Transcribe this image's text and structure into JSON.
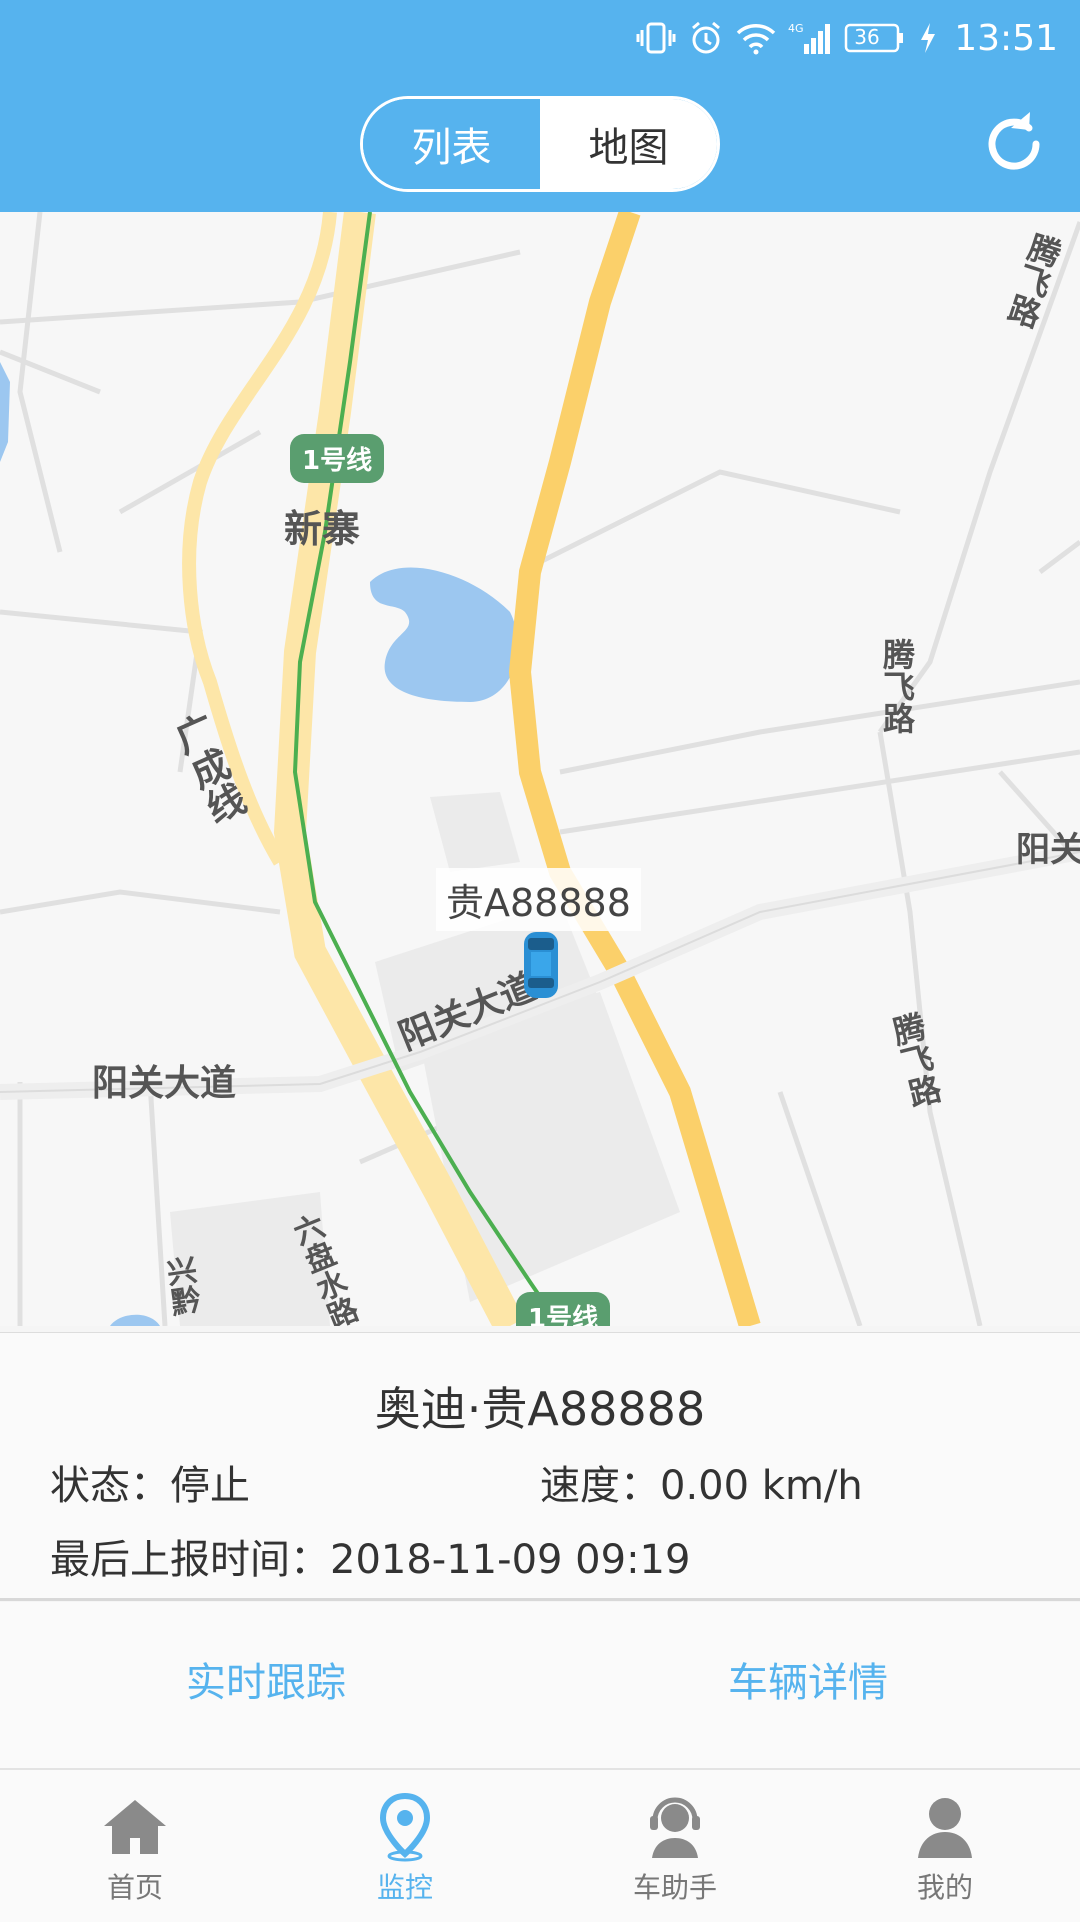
{
  "status_bar": {
    "network": "4G",
    "battery": "36",
    "time": "13:51"
  },
  "header": {
    "tabs": [
      {
        "label": "列表",
        "active": true
      },
      {
        "label": "地图",
        "active": false
      }
    ],
    "refresh_icon": "refresh-icon"
  },
  "map": {
    "place_labels": [
      "新寨",
      "广成线",
      "阳关大道",
      "阳关大道",
      "腾飞路",
      "腾飞路",
      "腾飞路",
      "阳关",
      "六盘水路",
      "兴黔"
    ],
    "metro_badges": [
      "1号线",
      "1号线"
    ],
    "vehicle_marker_label": "贵A88888"
  },
  "vehicle_info": {
    "title": "奥迪·贵A88888",
    "status_label": "状态：",
    "status_value": "停止",
    "speed_label": "速度：",
    "speed_value": "0.00 km/h",
    "last_report_label": "最后上报时间：",
    "last_report_value": "2018-11-09 09:19"
  },
  "actions": {
    "realtime_tracking": "实时跟踪",
    "vehicle_details": "车辆详情"
  },
  "bottom_nav": [
    {
      "label": "首页",
      "icon": "home-icon",
      "active": false
    },
    {
      "label": "监控",
      "icon": "location-pin-icon",
      "active": true
    },
    {
      "label": "车助手",
      "icon": "headset-assistant-icon",
      "active": false
    },
    {
      "label": "我的",
      "icon": "user-icon",
      "active": false
    }
  ],
  "colors": {
    "accent": "#56b3ee",
    "road_major": "#fbd06a",
    "road_minor": "#fde6a8",
    "metro_line": "#4caf50",
    "water": "#9cc7f0"
  }
}
